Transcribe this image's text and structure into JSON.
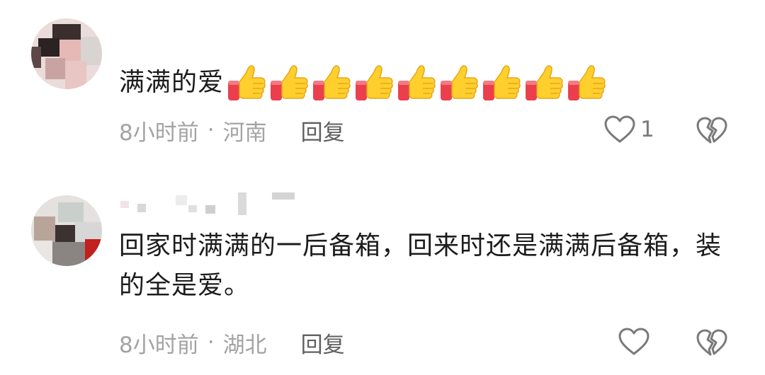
{
  "comments": [
    {
      "text": "满满的爱",
      "thumbs_count": 9,
      "time": "8小时前",
      "separator": "·",
      "location": "河南",
      "reply_label": "回复",
      "like_count": "1",
      "icons": {
        "like": "heart-outline-icon",
        "dislike": "broken-heart-icon",
        "emoji": "thumbs-up-emoji"
      }
    },
    {
      "text": "回家时满满的一后备箱，回来时还是满满后备箱，装的全是爱。",
      "time": "8小时前",
      "separator": "·",
      "location": "湖北",
      "reply_label": "回复",
      "like_count": "",
      "icons": {
        "like": "heart-outline-icon",
        "dislike": "broken-heart-icon"
      }
    }
  ],
  "colors": {
    "meta": "#a3a3a3",
    "reply": "#5f5f5f",
    "icon": "#7a7a7a",
    "text": "#1c1c1c"
  }
}
